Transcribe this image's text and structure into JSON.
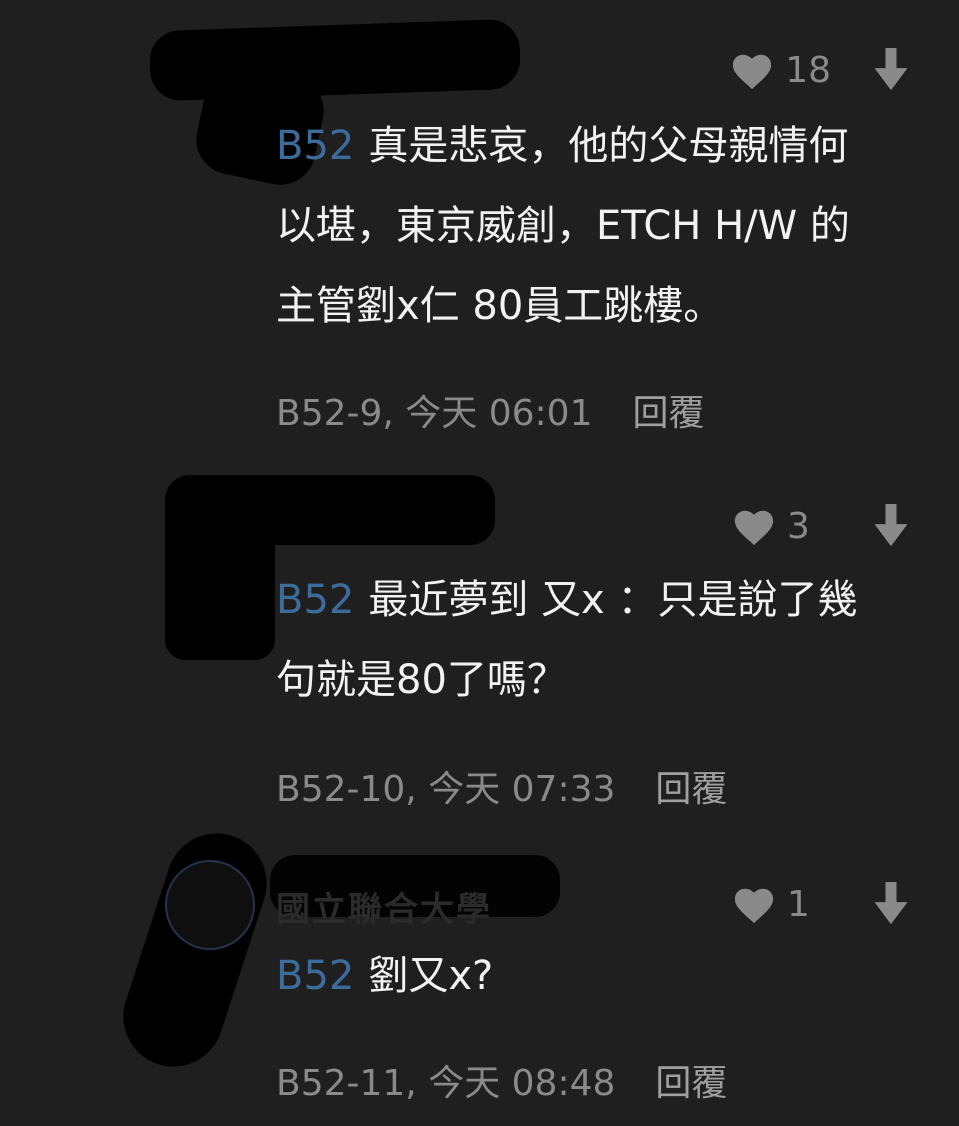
{
  "comments": [
    {
      "likes": "18",
      "user": "B52",
      "text": "真是悲哀，他的父母親情何以堪，東京威創，ETCH H/W 的主管劉x仁 80員工跳樓。",
      "meta": "B52-9, 今天 06:01",
      "reply": "回覆"
    },
    {
      "likes": "3",
      "user": "B52",
      "text": "最近夢到 又x ：只是說了幾句就是80了嗎？",
      "meta": "B52-10, 今天 07:33",
      "reply": "回覆"
    },
    {
      "author_hint": "國立聯合大學",
      "likes": "1",
      "user": "B52",
      "text": "劉又x?",
      "meta": "B52-11, 今天 08:48",
      "reply": "回覆"
    }
  ],
  "icons": {
    "like": "heart-icon",
    "downvote": "arrow-down-icon"
  },
  "colors": {
    "background": "#1f1f1f",
    "username": "#3d6b9c",
    "muted": "#8a8a8a",
    "text": "#f2f2f2"
  }
}
